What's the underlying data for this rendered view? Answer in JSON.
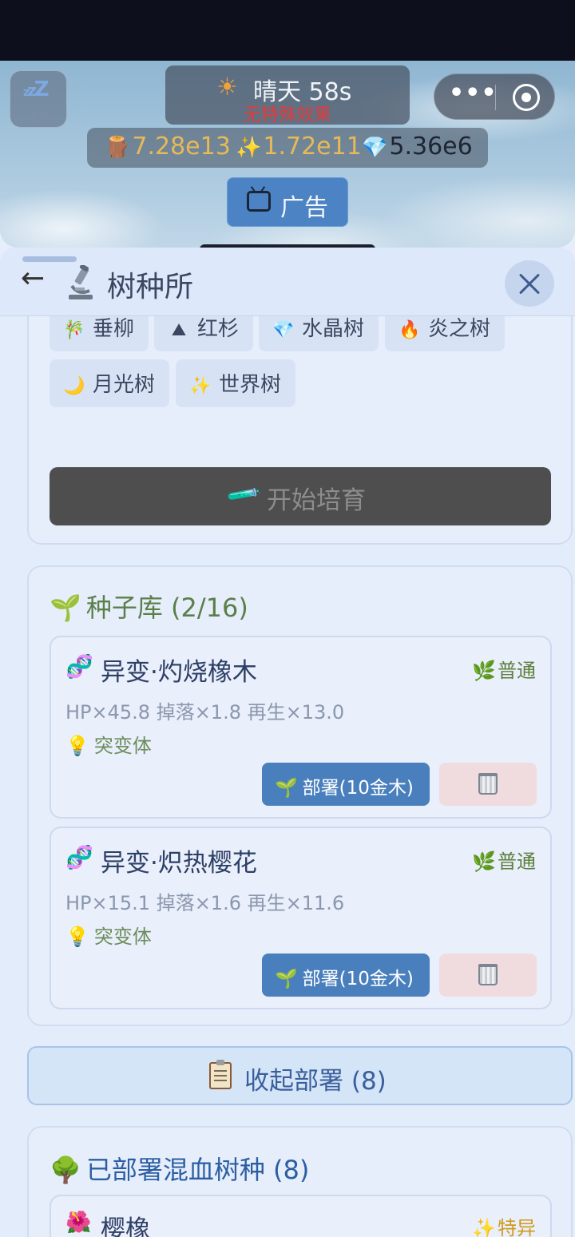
{
  "topbar": {
    "sleep_label": "省电",
    "weather": {
      "icon": "☀",
      "text": "晴天 58s",
      "effect": "无特殊效果"
    },
    "capsule": {
      "more": "•••"
    },
    "resources": [
      {
        "icon": "🪵",
        "value": "7.28e13"
      },
      {
        "icon": "✨",
        "value": "1.72e11"
      },
      {
        "icon": "💎",
        "value": "5.36e6"
      }
    ],
    "ad_label": "广告"
  },
  "panel": {
    "back": "←",
    "title": "树种所"
  },
  "breeding": {
    "trees": [
      {
        "icon": "🎋",
        "label": "垂柳"
      },
      {
        "icon": "⛰",
        "label": "红杉"
      },
      {
        "icon": "💎",
        "label": "水晶树"
      },
      {
        "icon": "🔥",
        "label": "炎之树"
      },
      {
        "icon": "🌙",
        "label": "月光树"
      },
      {
        "icon": "✨",
        "label": "世界树"
      }
    ],
    "start_icon": "🧪",
    "start_label": "开始培育"
  },
  "seed_bank": {
    "icon": "🌱",
    "title": "种子库 (2/16)",
    "seeds": [
      {
        "icon": "🧬",
        "name": "异变·灼烧橡木",
        "rarity_icon": "🌿",
        "rarity": "普通",
        "stats": "HP×45.8 掉落×1.8 再生×13.0",
        "trait_icon": "💡",
        "trait": "突变体",
        "deploy_icon": "🌱",
        "deploy_label": "部署(10金木)"
      },
      {
        "icon": "🧬",
        "name": "异变·炽热樱花",
        "rarity_icon": "🌿",
        "rarity": "普通",
        "stats": "HP×15.1 掉落×1.6 再生×11.6",
        "trait_icon": "💡",
        "trait": "突变体",
        "deploy_icon": "🌱",
        "deploy_label": "部署(10金木)"
      }
    ]
  },
  "collapse": {
    "label": "收起部署 (8)"
  },
  "deployed": {
    "icon": "🌳",
    "title": "已部署混血树种 (8)",
    "items": [
      {
        "icon": "🌺",
        "name": "樱橡",
        "rarity_icon": "✨",
        "rarity": "特异"
      }
    ]
  }
}
